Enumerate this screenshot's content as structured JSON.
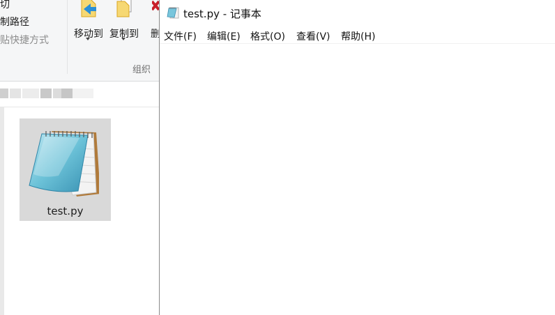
{
  "explorer": {
    "clipboard": {
      "cut_label": "剪切",
      "copy_path_label": "复制路径",
      "paste_shortcut_label": "粘贴快捷方式"
    },
    "organize": {
      "move_to_label": "移动到",
      "copy_to_label": "复制到",
      "delete_label": "删",
      "group_label": "组织"
    },
    "file": {
      "name": "test.py",
      "icon": "notepad-icon"
    }
  },
  "notepad": {
    "title": "test.py - 记事本",
    "menu": {
      "file": "文件(F)",
      "edit": "编辑(E)",
      "format": "格式(O)",
      "view": "查看(V)",
      "help": "帮助(H)"
    },
    "content": ""
  },
  "colors": {
    "ribbon_bg": "#f5f6f7",
    "selected_tile": "#d9d9d9",
    "folder_yellow": "#f2c94c",
    "arrow_blue": "#2b8fd6",
    "delete_red": "#c8202a"
  }
}
